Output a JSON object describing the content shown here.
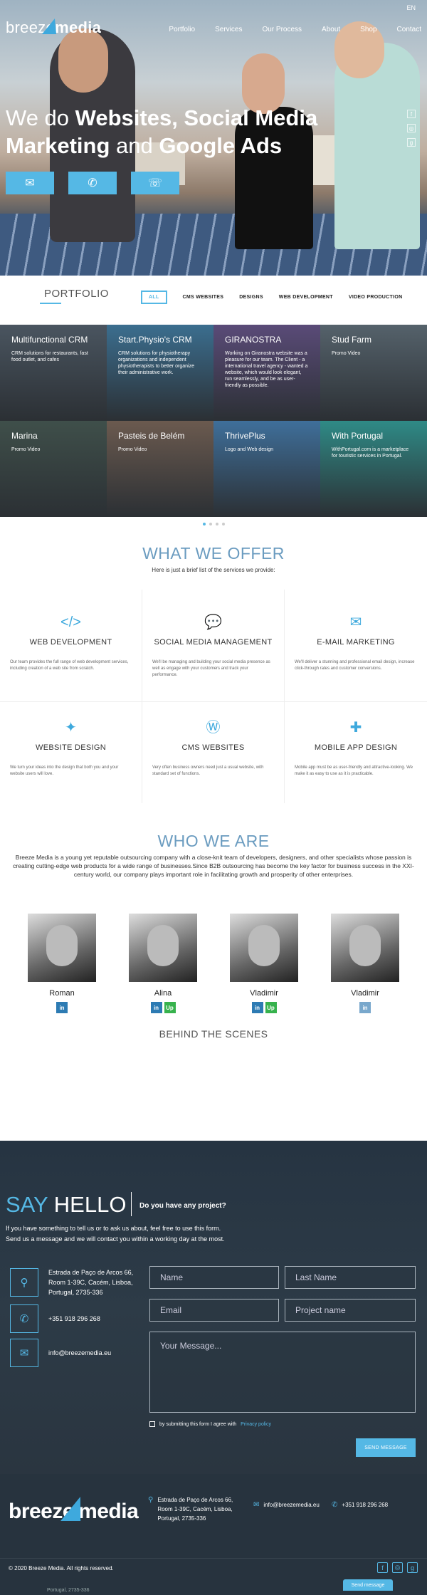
{
  "header": {
    "logo_a": "breeze",
    "logo_b": "media",
    "lang": "EN",
    "nav": [
      "Portfolio",
      "Services",
      "Our Process",
      "About",
      "Shop",
      "Contact"
    ]
  },
  "hero": {
    "line1_light": "We do ",
    "line1_bold": "Websites, Social Media",
    "line2_bold_a": "Marketing",
    "line2_light": " and ",
    "line2_bold_b": "Google Ads",
    "buttons": [
      "envelope-icon",
      "phone-icon",
      "chat-icon"
    ]
  },
  "portfolio": {
    "title": "PORTFOLIO",
    "filters": [
      "ALL",
      "CMS WEBSITES",
      "DESIGNS",
      "WEB DEVELOPMENT",
      "VIDEO PRODUCTION"
    ],
    "items": [
      {
        "title": "Multifunctional CRM",
        "desc": "CRM solutions for restaurants, fast food outlet, and cafes",
        "color": "#4a5560"
      },
      {
        "title": "Start.Physio's CRM",
        "desc": "CRM solutions for physiotherapy organizations and independent physiotherapists to better organize their administrative work.",
        "color": "#3b6e8f"
      },
      {
        "title": "GIRANOSTRA",
        "desc": "Working on Giranostra website was a pleasure for our team. The Client - a international travel agency - wanted a website, which would look elegant, run seamlessly, and be as user-friendly as possible.",
        "color": "#5a4b78"
      },
      {
        "title": "Stud Farm",
        "desc": "Promo Video",
        "color": "#55626b"
      },
      {
        "title": "Marina",
        "desc": "Promo Video",
        "color": "#3f4f4a"
      },
      {
        "title": "Pasteis de Belém",
        "desc": "Promo Video",
        "color": "#6b5a4f"
      },
      {
        "title": "ThrivePlus",
        "desc": "Logo and Web design",
        "color": "#3f6f9a"
      },
      {
        "title": "With Portugal",
        "desc": "WithPortugal.com is a marketplace for touristic services in Portugal.",
        "color": "#2f8a86"
      }
    ]
  },
  "offer": {
    "title": "WHAT WE OFFER",
    "subtitle": "Here is just a brief list of the services we provide:",
    "services": [
      {
        "icon": "code-icon",
        "glyph": "</>",
        "title": "WEB DEVELOPMENT",
        "desc": "Our team provides the full range of web development services, including creation of a web site from scratch."
      },
      {
        "icon": "chat-bubbles-icon",
        "glyph": "💬",
        "title": "SOCIAL MEDIA MANAGEMENT",
        "desc": "We'll be managing and building your social media presence as well as engage with your customers and track your performance."
      },
      {
        "icon": "mail-icon",
        "glyph": "✉",
        "title": "E-MAIL MARKETING",
        "desc": "We'll deliver a stunning and professional email design, increase click-through rates and customer conversions."
      },
      {
        "icon": "magic-wand-icon",
        "glyph": "✦",
        "title": "WEBSITE DESIGN",
        "desc": "We turn your ideas into the design that both you and your website users will love."
      },
      {
        "icon": "wordpress-icon",
        "glyph": "Ⓦ",
        "title": "CMS WEBSITES",
        "desc": "Very often business owners need just a usual website, with standard set of functions."
      },
      {
        "icon": "puzzle-icon",
        "glyph": "✚",
        "title": "MOBILE APP DESIGN",
        "desc": "Mobile app must be as user-friendly and attractive-looking. We make it as easy to use as it is practicable."
      }
    ]
  },
  "who": {
    "title": "WHO WE ARE",
    "text": "Breeze Media is a young yet reputable outsourcing company with a close-knit team of developers, designers, and other specialists whose passion is creating cutting-edge web products for a wide range of businesses.Since B2B outsourcing has become the key factor for business success in the XXI-century world, our company plays important role in facilitating growth and prosperity of other enterprises.",
    "team": [
      {
        "name": "Roman",
        "links": [
          "in"
        ]
      },
      {
        "name": "Alina",
        "links": [
          "in",
          "Up"
        ]
      },
      {
        "name": "Vladimir",
        "links": [
          "in",
          "Up"
        ]
      },
      {
        "name": "Vladimir",
        "links": [
          "in"
        ]
      }
    ],
    "behind": "BEHIND THE SCENES"
  },
  "contact": {
    "say": "SAY",
    "hello": " HELLO",
    "question": "Do you have any project?",
    "text1": "If you have something to tell us or to ask us about, feel free to use this form.",
    "text2": "Send us a message and we will contact you within a working day at the most.",
    "address": "Estrada de Paço de Arcos 66, Room 1-39C, Cacém, Lisboa, Portugal, 2735-336",
    "phone": "+351 918 296 268",
    "email": "info@breezemedia.eu",
    "placeholders": {
      "name": "Name",
      "last": "Last Name",
      "email": "Email",
      "project": "Project name",
      "message": "Your Message..."
    },
    "agree": "by submitting this form I agree with",
    "privacy": "Privacy policy",
    "send": "SEND MESSAGE"
  },
  "footer": {
    "logo_a": "breeze",
    "logo_b": "media",
    "address1": "Estrada de Paço de Arcos 66,",
    "address2": "Room 1-39C, Cacém, Lisboa,",
    "address3": "Portugal, 2735-336",
    "email": "info@breezemedia.eu",
    "phone": "+351 918 296 268",
    "copyright": "© 2020 Breeze Media. All rights reserved.",
    "send_tab": "Send message",
    "bottom_stub": "Portugal, 2735-336"
  },
  "colors": {
    "accent": "#55b8e5",
    "dark": "#27333e",
    "title_blue": "#6b9cc0"
  }
}
